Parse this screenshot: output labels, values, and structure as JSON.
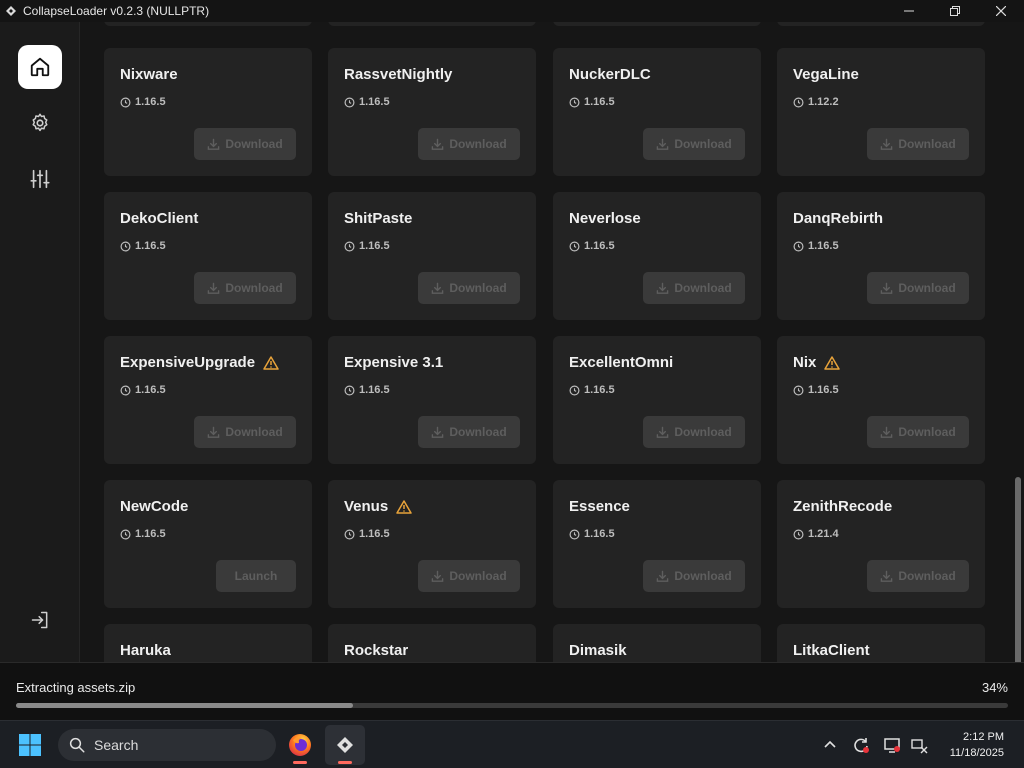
{
  "window": {
    "title": "CollapseLoader v0.2.3 (NULLPTR)",
    "controls": [
      "minimize-icon",
      "restore-icon",
      "close-icon"
    ]
  },
  "sidebar": {
    "items": [
      {
        "name": "home",
        "icon": "home-icon",
        "active": true
      },
      {
        "name": "settings",
        "icon": "gear-icon",
        "active": false
      },
      {
        "name": "customize",
        "icon": "sliders-icon",
        "active": false
      }
    ],
    "bottom_icon": "logout-icon"
  },
  "clients": [
    {
      "name": "Nixware",
      "version": "1.16.5",
      "action": "Download",
      "warning": false
    },
    {
      "name": "RassvetNightly",
      "version": "1.16.5",
      "action": "Download",
      "warning": false
    },
    {
      "name": "NuckerDLC",
      "version": "1.16.5",
      "action": "Download",
      "warning": false
    },
    {
      "name": "VegaLine",
      "version": "1.12.2",
      "action": "Download",
      "warning": false
    },
    {
      "name": "DekoClient",
      "version": "1.16.5",
      "action": "Download",
      "warning": false
    },
    {
      "name": "ShitPaste",
      "version": "1.16.5",
      "action": "Download",
      "warning": false
    },
    {
      "name": "Neverlose",
      "version": "1.16.5",
      "action": "Download",
      "warning": false
    },
    {
      "name": "DanqRebirth",
      "version": "1.16.5",
      "action": "Download",
      "warning": false
    },
    {
      "name": "ExpensiveUpgrade",
      "version": "1.16.5",
      "action": "Download",
      "warning": true
    },
    {
      "name": "Expensive 3.1",
      "version": "1.16.5",
      "action": "Download",
      "warning": false
    },
    {
      "name": "ExcellentOmni",
      "version": "1.16.5",
      "action": "Download",
      "warning": false
    },
    {
      "name": "Nix",
      "version": "1.16.5",
      "action": "Download",
      "warning": true
    },
    {
      "name": "NewCode",
      "version": "1.16.5",
      "action": "Launch",
      "warning": false
    },
    {
      "name": "Venus",
      "version": "1.16.5",
      "action": "Download",
      "warning": true
    },
    {
      "name": "Essence",
      "version": "1.16.5",
      "action": "Download",
      "warning": false
    },
    {
      "name": "ZenithRecode",
      "version": "1.21.4",
      "action": "Download",
      "warning": false
    },
    {
      "name": "Haruka",
      "version": "",
      "action": "",
      "warning": false
    },
    {
      "name": "Rockstar",
      "version": "",
      "action": "",
      "warning": false
    },
    {
      "name": "Dimasik",
      "version": "",
      "action": "",
      "warning": false
    },
    {
      "name": "LitkaClient",
      "version": "",
      "action": "",
      "warning": false
    }
  ],
  "progress": {
    "label": "Extracting assets.zip",
    "percent_text": "34%",
    "value": 0.34
  },
  "taskbar": {
    "search_placeholder": "Search",
    "apps": [
      "firefox-icon",
      "collapseloader-icon"
    ],
    "time": "2:12 PM",
    "date": "11/18/2025"
  },
  "colors": {
    "accent_warning": "#e8a33a",
    "progress_indicator": "#ff6a5e"
  }
}
